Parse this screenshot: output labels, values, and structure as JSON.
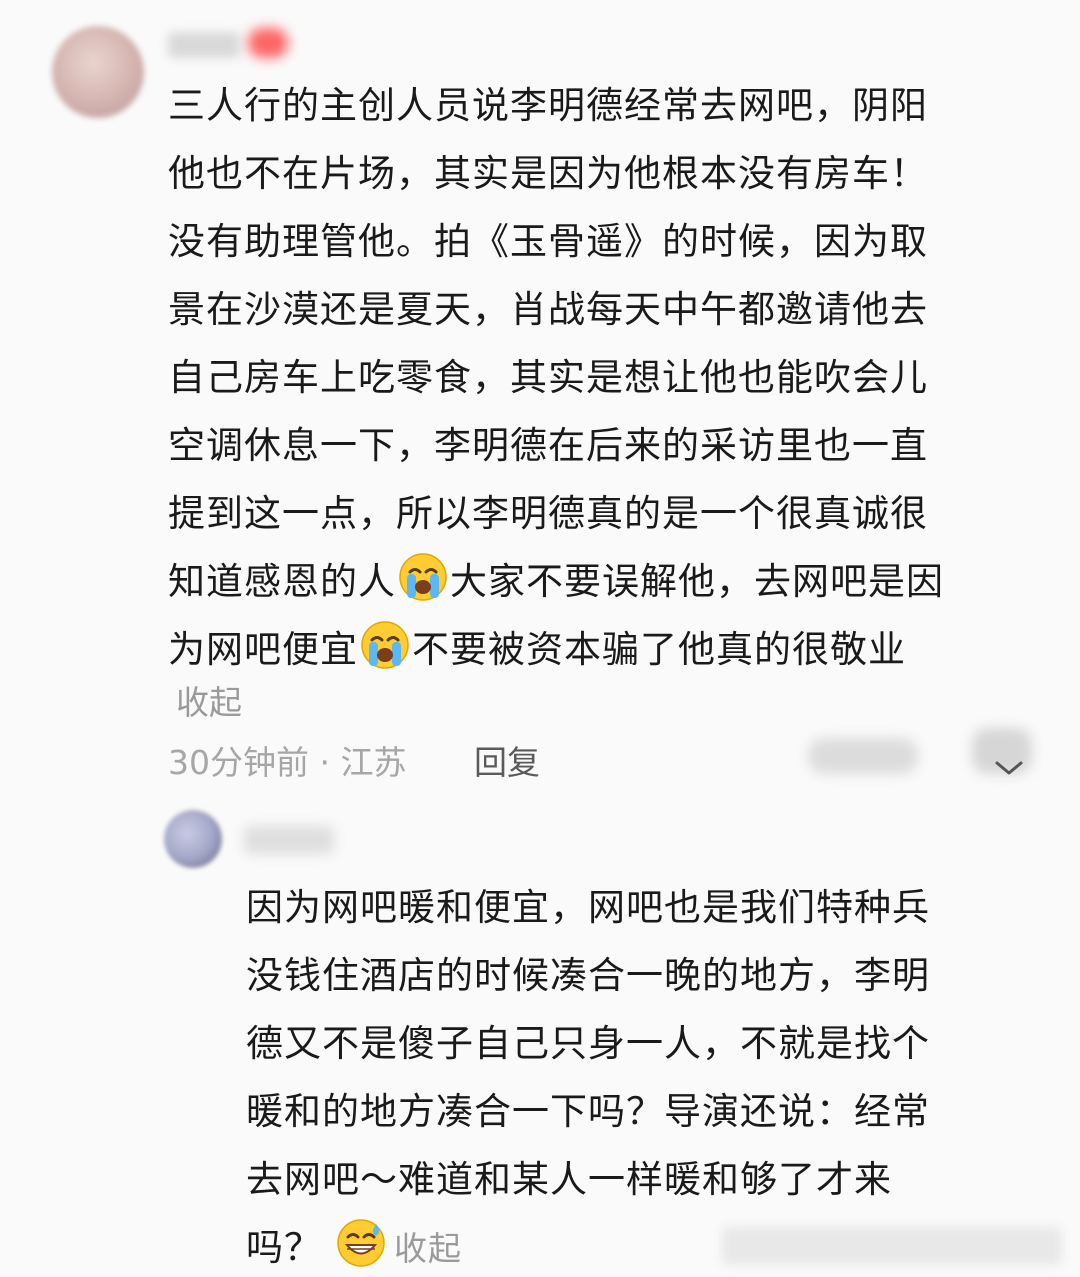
{
  "comment": {
    "text_part1": "三人行的主创人员说李明德经常去网吧，阴阳\n他也不在片场，其实是因为他根本没有房车！\n没有助理管他。拍《玉骨遥》的时候，因为取\n景在沙漠还是夏天，肖战每天中午都邀请他去\n自己房车上吃零食，其实是想让他也能吹会儿\n空调休息一下，李明德在后来的采访里也一直\n提到这一点，所以李明德真的是一个很真诚很\n知道感恩的人",
    "text_part2": "大家不要误解他，去网吧是因\n为网吧便宜",
    "text_part3": "不要被资本骗了他真的很敬业",
    "collapse": "收起",
    "time_location": "30分钟前 · 江苏",
    "reply_label": "回复"
  },
  "reply": {
    "text": "因为网吧暖和便宜，网吧也是我们特种兵\n没钱住酒店的时候凑合一晚的地方，李明\n德又不是傻子自己只身一人，不就是找个\n暖和的地方凑合一下吗？导演还说：经常\n去网吧～难道和某人一样暖和够了才来\n吗？",
    "collapse": "收起"
  },
  "emoji": {
    "crying": "loudly-crying-face-icon",
    "sweat_grin": "grinning-sweat-face-icon"
  }
}
